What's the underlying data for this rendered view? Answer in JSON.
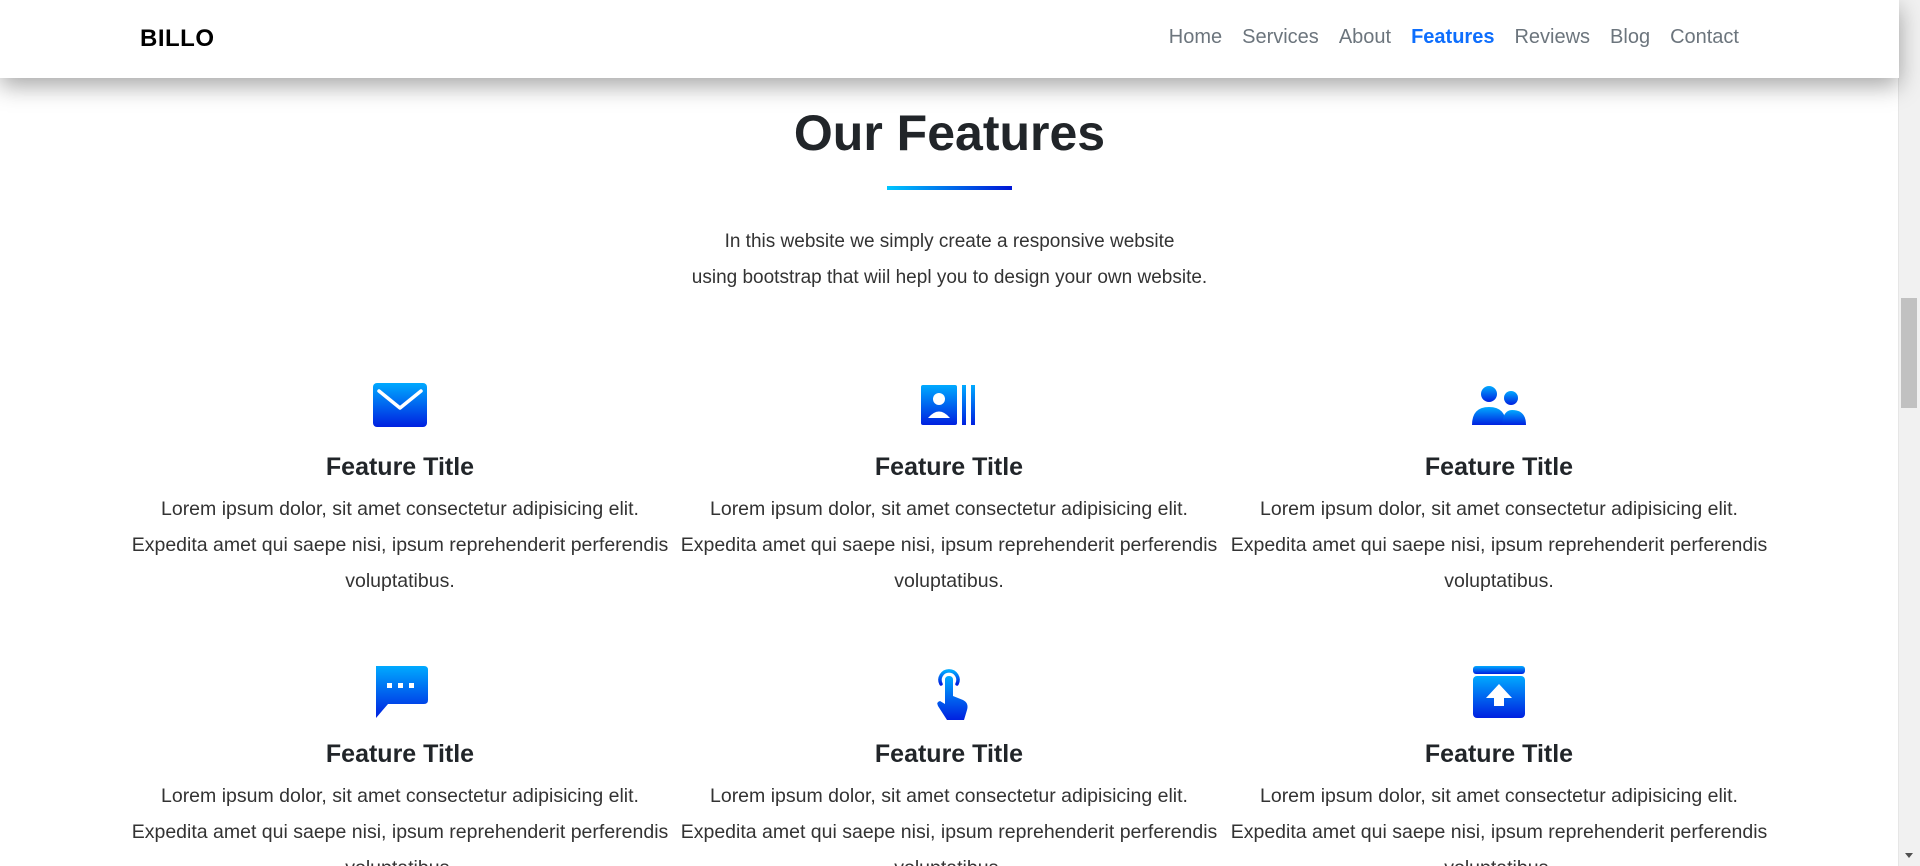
{
  "navbar": {
    "brand": "BILLO",
    "links": [
      {
        "label": "Home",
        "active": false
      },
      {
        "label": "Services",
        "active": false
      },
      {
        "label": "About",
        "active": false
      },
      {
        "label": "Features",
        "active": true
      },
      {
        "label": "Reviews",
        "active": false
      },
      {
        "label": "Blog",
        "active": false
      },
      {
        "label": "Contact",
        "active": false
      }
    ],
    "active_color": "#0d6efd"
  },
  "section": {
    "title": "Our Features",
    "description_line1": "In this website we simply create a responsive website",
    "description_line2": "using bootstrap that wiil hepl you to design your own website."
  },
  "accent_gradient": [
    "#00c6ff",
    "#0015d6"
  ],
  "features": [
    {
      "icon": "envelope-icon",
      "title": "Feature Title",
      "text": "Lorem ipsum dolor, sit amet consectetur adipisicing elit. Expedita amet qui saepe nisi, ipsum reprehenderit perferendis voluptatibus."
    },
    {
      "icon": "person-badge-icon",
      "title": "Feature Title",
      "text": "Lorem ipsum dolor, sit amet consectetur adipisicing elit. Expedita amet qui saepe nisi, ipsum reprehenderit perferendis voluptatibus."
    },
    {
      "icon": "people-icon",
      "title": "Feature Title",
      "text": "Lorem ipsum dolor, sit amet consectetur adipisicing elit. Expedita amet qui saepe nisi, ipsum reprehenderit perferendis voluptatibus."
    },
    {
      "icon": "chat-dots-icon",
      "title": "Feature Title",
      "text": "Lorem ipsum dolor, sit amet consectetur adipisicing elit. Expedita amet qui saepe nisi, ipsum reprehenderit perferendis voluptatibus."
    },
    {
      "icon": "hand-pointer-icon",
      "title": "Feature Title",
      "text": "Lorem ipsum dolor, sit amet consectetur adipisicing elit. Expedita amet qui saepe nisi, ipsum reprehenderit perferendis voluptatibus."
    },
    {
      "icon": "box-upload-icon",
      "title": "Feature Title",
      "text": "Lorem ipsum dolor, sit amet consectetur adipisicing elit. Expedita amet qui saepe nisi, ipsum reprehenderit perferendis voluptatibus."
    }
  ]
}
